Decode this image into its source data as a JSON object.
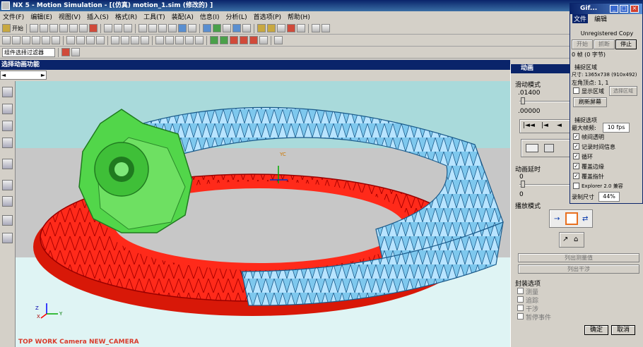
{
  "window": {
    "title": "NX 5 - Motion Simulation - [(仿真) motion_1.sim  (修改的) ]"
  },
  "menu": [
    "文件(F)",
    "编辑(E)",
    "视图(V)",
    "插入(S)",
    "格式(R)",
    "工具(T)",
    "装配(A)",
    "信息(I)",
    "分析(L)",
    "首选项(P)",
    "帮助(H)"
  ],
  "toolbar": {
    "start_label": "开始",
    "filter_value": "组件选择过滤器"
  },
  "selection_bar": {
    "label": "选择动画功能"
  },
  "viewport": {
    "camera_label": "TOP WORK Camera NEW_CAMERA",
    "axis_yc": "YC",
    "axis_z": "Z",
    "axis_x": "X",
    "axis_y": "Y"
  },
  "animation_panel": {
    "title": "动画",
    "slide_mode_label": "滑动模式",
    "value_top": ".01400",
    "value_bottom": ".00000",
    "delay_label": "动画延时",
    "delay_value_top": "0",
    "delay_value_bottom": "0",
    "playback_label": "播放模式",
    "list_measure_label": "列出测量值",
    "list_interference_label": "列出干涉",
    "encapsulate_label": "封装选项",
    "options": [
      "测量",
      "追踪",
      "干涉",
      "暂停事件"
    ],
    "ok_label": "确定",
    "cancel_label": "取消"
  },
  "gif_tool": {
    "title": "Gif...",
    "menu": [
      "文件",
      "编辑"
    ],
    "registration": "Unregistered Copy",
    "start_label": "开始",
    "pause_label": "抓断",
    "stop_label": "停止",
    "frames_info": "0 帧 (0 字节)",
    "capture_area_label": "捕捉区域",
    "size_info": "尺寸: 1365x738 (910x492)",
    "corner_info": "左角顶点:     1, 1",
    "show_area_label": "显示区域",
    "select_area_label": "选择区域",
    "refresh_label": "刷新屏幕",
    "capture_options_label": "捕捉选项",
    "max_fps_label": "最大帧频:",
    "max_fps_value": "10 fps",
    "options": [
      "帧间透明",
      "记录时间信息",
      "循环",
      "覆盖边缘",
      "覆盖指针",
      "Explorer 2.0 兼容"
    ],
    "options_checked": [
      true,
      true,
      true,
      true,
      true,
      false
    ],
    "record_size_label": "录制尺寸",
    "record_size_value": "44%"
  }
}
